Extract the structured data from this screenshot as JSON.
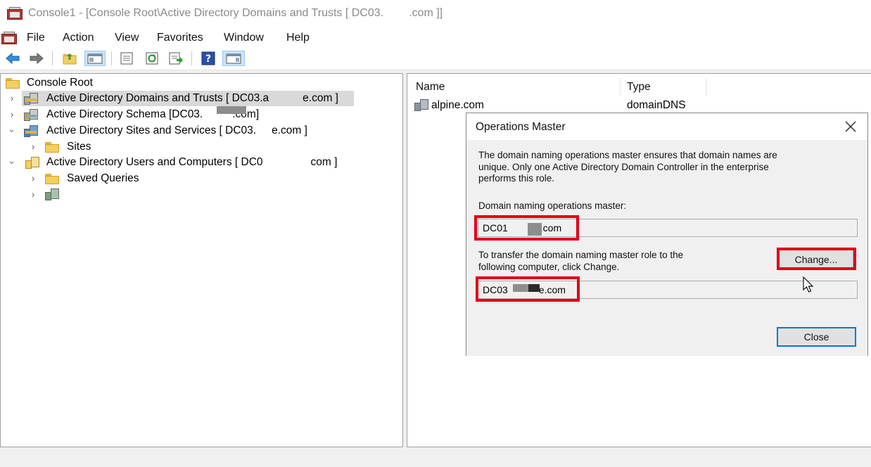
{
  "window": {
    "title": "Console1 - [Console Root\\Active Directory Domains and Trusts [ DC03.",
    "title_suffix": ".com ]]"
  },
  "menu": [
    "File",
    "Action",
    "View",
    "Favorites",
    "Window",
    "Help"
  ],
  "toolbar": {
    "icons": [
      "back-arrow-icon",
      "forward-arrow-icon",
      "up-folder-icon",
      "show-hide-tree-icon",
      "properties-icon",
      "refresh-icon",
      "export-list-icon",
      "help-icon",
      "show-hide-action-pane-icon"
    ]
  },
  "tree": {
    "root": "Console Root",
    "items": [
      {
        "label": "Active Directory Domains and Trusts [ DC03.a",
        "suffix": "e.com ]",
        "expanded": false,
        "selected": true
      },
      {
        "label": "Active Directory Schema [DC03.",
        "suffix": ".com]",
        "expanded": false
      },
      {
        "label": "Active Directory Sites and Services [ DC03.",
        "suffix": "e.com ]",
        "expanded": true
      },
      {
        "label": "Sites",
        "expanded": false
      },
      {
        "label": "Active Directory Users and Computers [ DC0",
        "suffix": "com ]",
        "expanded": true
      },
      {
        "label": "Saved Queries",
        "expanded": false
      },
      {
        "label": "",
        "expanded": false
      }
    ]
  },
  "list": {
    "columns": [
      "Name",
      "Type"
    ],
    "rows": [
      {
        "name": "alpine.com",
        "type": "domainDNS"
      }
    ]
  },
  "dialog": {
    "title": "Operations Master",
    "description_lines": [
      "The domain naming operations master ensures that domain names are",
      "unique. Only one Active Directory Domain Controller in the enterprise",
      "performs this role."
    ],
    "current_label": "Domain naming operations master:",
    "current_value_prefix": "DC01",
    "current_value_suffix": ".com",
    "transfer_lines": [
      "To transfer the domain naming master role to the",
      "following computer, click Change."
    ],
    "target_value_prefix": "DC03",
    "target_value_suffix": "e.com",
    "change_button": "Change...",
    "close_button": "Close"
  },
  "colors": {
    "highlight": "#e0001a",
    "selection": "#d9d9d9",
    "default_button_border": "#0078d7"
  }
}
